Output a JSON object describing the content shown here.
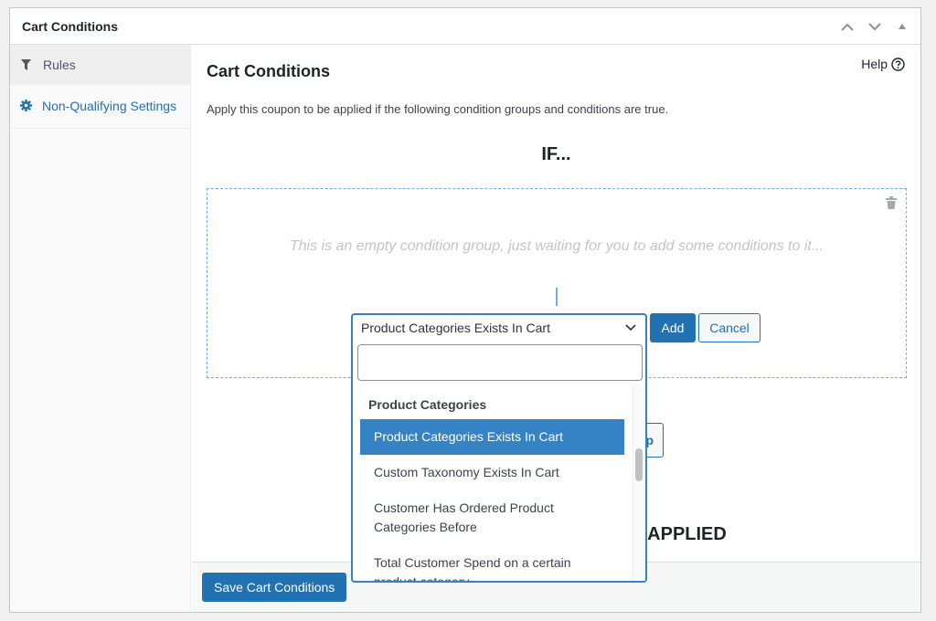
{
  "panel": {
    "title": "Cart Conditions",
    "controls": [
      "move-up",
      "move-down",
      "toggle-collapse"
    ]
  },
  "sidebar": {
    "items": [
      {
        "label": "Rules",
        "icon": "filter-icon",
        "active": true
      },
      {
        "label": "Non-Qualifying Settings",
        "icon": "gear-icon",
        "active": false
      }
    ]
  },
  "main": {
    "title": "Cart Conditions",
    "help_label": "Help",
    "description": "Apply this coupon to be applied if the following condition groups and conditions are true.",
    "if_heading": "IF...",
    "group": {
      "empty_message": "This is an empty condition group, just waiting for you to add some conditions to it..."
    },
    "hidden_button_fragment": "p",
    "then_heading_fragment": "E APPLIED"
  },
  "condition_select": {
    "selected_value": "Product Categories Exists In Cart",
    "search_value": "",
    "group_label": "Product Categories",
    "options": [
      {
        "label": "Product Categories Exists In Cart",
        "selected": true
      },
      {
        "label": "Custom Taxonomy Exists In Cart",
        "selected": false
      },
      {
        "label": "Customer Has Ordered Product Categories Before",
        "selected": false
      },
      {
        "label": "Total Customer Spend on a certain product category",
        "selected": false
      }
    ],
    "add_label": "Add",
    "cancel_label": "Cancel"
  },
  "footer": {
    "save_label": "Save Cart Conditions"
  },
  "colors": {
    "accent": "#2271b1",
    "selected_option": "#3582c4",
    "dashed_border": "#72aee6",
    "page_bg": "#f0f0f1"
  }
}
